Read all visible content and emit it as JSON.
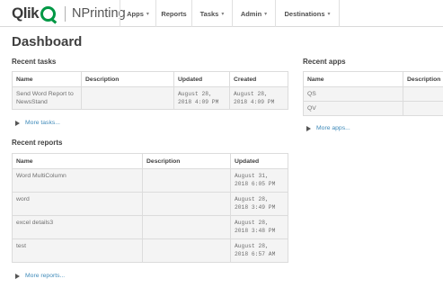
{
  "brand": {
    "logo_text": "Qlik",
    "product": "NPrinting",
    "accent": "#009845"
  },
  "nav": {
    "items": [
      {
        "label": "Apps",
        "caret": "▾"
      },
      {
        "label": "Reports",
        "caret": ""
      },
      {
        "label": "Tasks",
        "caret": "▾"
      },
      {
        "label": "Admin",
        "caret": "▾"
      },
      {
        "label": "Destinations",
        "caret": "▾"
      }
    ]
  },
  "page": {
    "title": "Dashboard"
  },
  "recent_tasks": {
    "title": "Recent tasks",
    "columns": [
      "Name",
      "Description",
      "Updated",
      "Created"
    ],
    "rows": [
      {
        "name": "Send Word Report to NewsStand",
        "description": "",
        "updated": "August 28, 2018 4:09 PM",
        "created": "August 28, 2018 4:09 PM"
      }
    ],
    "more_label": "More tasks..."
  },
  "recent_reports": {
    "title": "Recent reports",
    "columns": [
      "Name",
      "Description",
      "Updated"
    ],
    "rows": [
      {
        "name": "Word MultiColumn",
        "description": "",
        "updated": "August 31, 2018 6:05 PM"
      },
      {
        "name": "word",
        "description": "",
        "updated": "August 28, 2018 3:49 PM"
      },
      {
        "name": "excel details3",
        "description": "",
        "updated": "August 28, 2018 3:48 PM"
      },
      {
        "name": "test",
        "description": "",
        "updated": "August 28, 2018 6:57 AM"
      }
    ],
    "more_label": "More reports..."
  },
  "recent_apps": {
    "title": "Recent apps",
    "columns": [
      "Name",
      "Description"
    ],
    "rows": [
      {
        "name": "QS",
        "description": ""
      },
      {
        "name": "QV",
        "description": ""
      }
    ],
    "more_label": "More apps..."
  }
}
